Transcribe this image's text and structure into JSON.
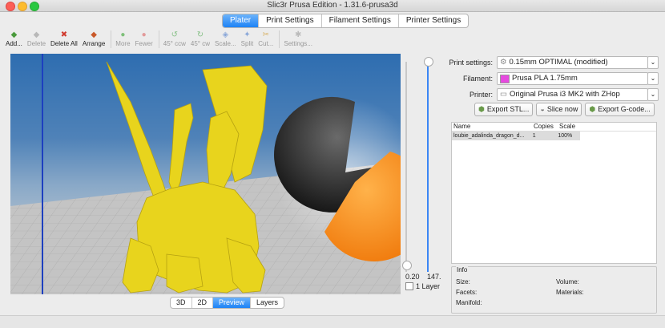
{
  "window": {
    "title": "Slic3r Prusa Edition - 1.31.6-prusa3d"
  },
  "tabs": [
    {
      "label": "Plater",
      "active": true
    },
    {
      "label": "Print Settings",
      "active": false
    },
    {
      "label": "Filament Settings",
      "active": false
    },
    {
      "label": "Printer Settings",
      "active": false
    }
  ],
  "toolbar": {
    "add": "Add...",
    "delete": "Delete",
    "delete_all": "Delete All",
    "arrange": "Arrange",
    "more": "More",
    "fewer": "Fewer",
    "rotate_ccw": "45° ccw",
    "rotate_cw": "45° cw",
    "scale": "Scale...",
    "split": "Split",
    "cut": "Cut...",
    "settings": "Settings..."
  },
  "slider": {
    "low": "0.20",
    "high": "147.",
    "layer_label": "1 Layer"
  },
  "view_buttons": [
    {
      "label": "3D",
      "active": false
    },
    {
      "label": "2D",
      "active": false
    },
    {
      "label": "Preview",
      "active": true
    },
    {
      "label": "Layers",
      "active": false
    }
  ],
  "settings": {
    "print_label": "Print settings:",
    "print_value": "0.15mm OPTIMAL (modified)",
    "filament_label": "Filament:",
    "filament_value": "Prusa PLA 1.75mm",
    "filament_color": "#e64adf",
    "printer_label": "Printer:",
    "printer_value": "Original Prusa i3 MK2 with ZHop"
  },
  "actions": {
    "export_stl": "Export STL...",
    "slice_now": "Slice now",
    "export_gcode": "Export G-code..."
  },
  "object_list": {
    "columns": [
      "Name",
      "Copies",
      "Scale"
    ],
    "rows": [
      {
        "name": "loubie_adalinda_dragon_d...",
        "copies": "1",
        "scale": "100%"
      }
    ]
  },
  "info": {
    "title": "Info",
    "size": "Size:",
    "volume": "Volume:",
    "facets": "Facets:",
    "materials": "Materials:",
    "manifold": "Manifold:"
  }
}
